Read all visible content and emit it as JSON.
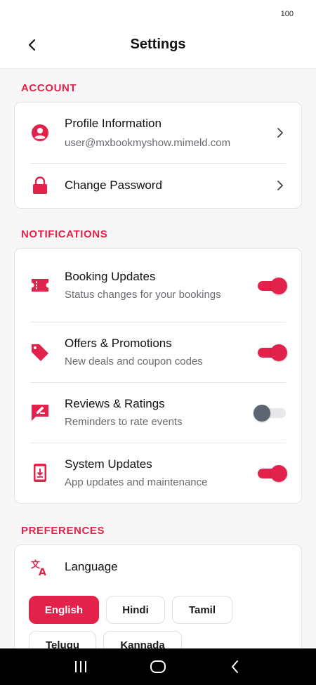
{
  "status_bar": {
    "battery": "100"
  },
  "header": {
    "title": "Settings"
  },
  "sections": {
    "account": {
      "title": "ACCOUNT",
      "profile": {
        "label": "Profile Information",
        "email": "user@mxbookmyshow.mimeld.com"
      },
      "password": {
        "label": "Change Password"
      }
    },
    "notifications": {
      "title": "NOTIFICATIONS",
      "items": [
        {
          "label": "Booking Updates",
          "sub": "Status changes for your bookings",
          "enabled": true
        },
        {
          "label": "Offers & Promotions",
          "sub": "New deals and coupon codes",
          "enabled": true
        },
        {
          "label": "Reviews & Ratings",
          "sub": "Reminders to rate events",
          "enabled": false
        },
        {
          "label": "System Updates",
          "sub": "App updates and maintenance",
          "enabled": true
        }
      ]
    },
    "preferences": {
      "title": "PREFERENCES",
      "language": {
        "label": "Language",
        "options": [
          "English",
          "Hindi",
          "Tamil",
          "Telugu",
          "Kannada"
        ],
        "selected": "English"
      }
    }
  },
  "colors": {
    "accent": "#e3224b",
    "toggle_off_knob": "#5b6470"
  },
  "icons": {
    "back": "arrow-left-icon",
    "profile": "user-circle-icon",
    "password": "lock-icon",
    "booking": "ticket-icon",
    "offers": "tag-icon",
    "reviews": "rate-review-icon",
    "system": "system-update-icon",
    "language": "translate-icon"
  }
}
